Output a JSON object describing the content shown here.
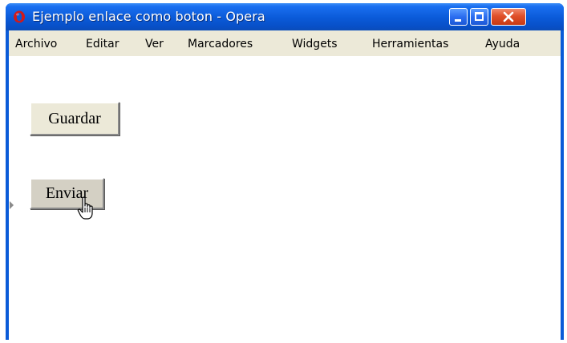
{
  "window": {
    "title": "Ejemplo enlace como boton - Opera",
    "app_icon": "opera-icon",
    "controls": {
      "minimize": "minimize-icon",
      "maximize": "maximize-icon",
      "close": "close-icon"
    },
    "colors": {
      "titlebar": "#0a5ad8",
      "close_button": "#e0502a",
      "menubar": "#ece9d8",
      "content": "#ffffff"
    }
  },
  "menu": {
    "items": [
      {
        "label": "Archivo"
      },
      {
        "label": "Editar"
      },
      {
        "label": "Ver"
      },
      {
        "label": "Marcadores"
      },
      {
        "label": "Widgets"
      },
      {
        "label": "Herramientas"
      },
      {
        "label": "Ayuda"
      }
    ]
  },
  "content": {
    "buttons": {
      "guardar": {
        "label": "Guardar"
      },
      "enviar": {
        "label": "Enviar",
        "state": "hover"
      }
    },
    "cursor": "hand-pointer-icon"
  }
}
